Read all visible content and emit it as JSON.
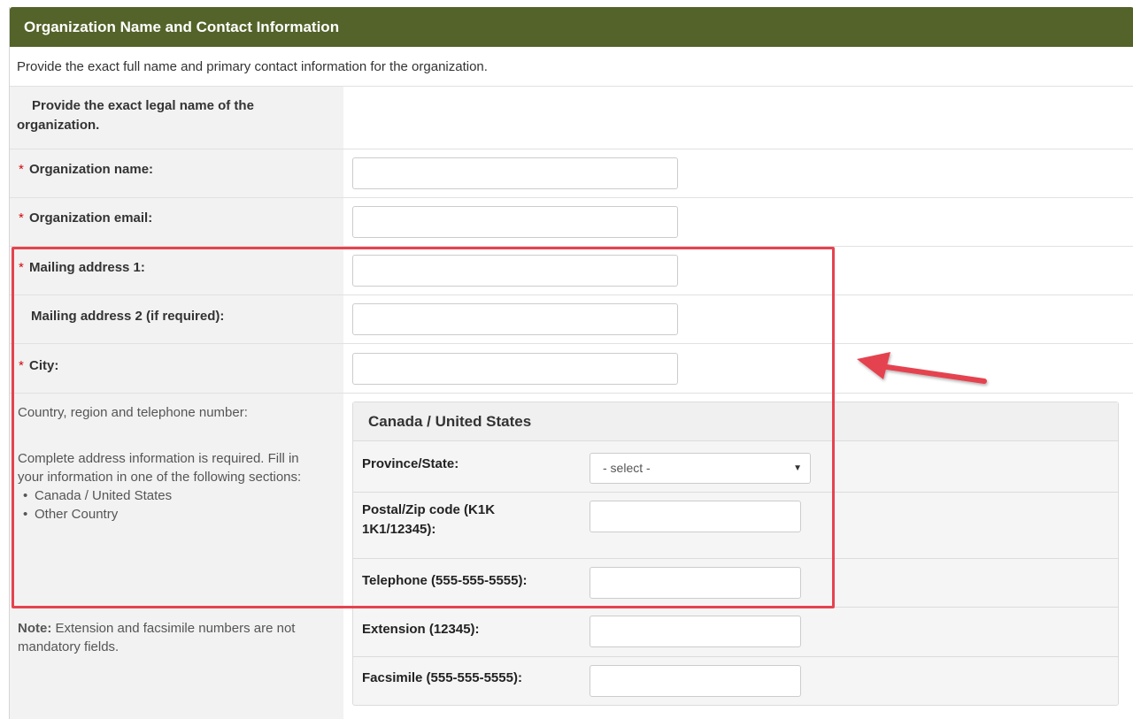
{
  "section": {
    "title": "Organization Name and Contact Information",
    "intro": "Provide the exact full name and primary contact information for the organization."
  },
  "legal_name_note": "Provide the exact legal name of the organization.",
  "fields": {
    "org_name": {
      "label": "Organization name:",
      "value": ""
    },
    "org_email": {
      "label": "Organization email:",
      "value": ""
    },
    "address1": {
      "label": "Mailing address 1:",
      "value": ""
    },
    "address2": {
      "label": "Mailing address 2 (if required):",
      "value": ""
    },
    "city": {
      "label": "City:",
      "value": ""
    }
  },
  "required_marker": "*",
  "country_info": {
    "heading": "Country, region and telephone number:",
    "instructions": "Complete address information is required. Fill in your information in one of the following sections:",
    "options": [
      "Canada / United States",
      "Other Country"
    ],
    "note_bold": "Note:",
    "note_text": " Extension and facsimile numbers are not mandatory fields."
  },
  "canada_us": {
    "heading": "Canada / United States",
    "province_label": "Province/State:",
    "province_value": "- select -",
    "postal_label": "Postal/Zip code (K1K 1K1/12345):",
    "telephone_label": "Telephone (555-555-5555):",
    "extension_label": "Extension (12345):",
    "fax_label": "Facsimile (555-555-5555):"
  },
  "colors": {
    "header_bg": "#536329",
    "required": "#d3080c",
    "highlight": "#e5434f"
  }
}
